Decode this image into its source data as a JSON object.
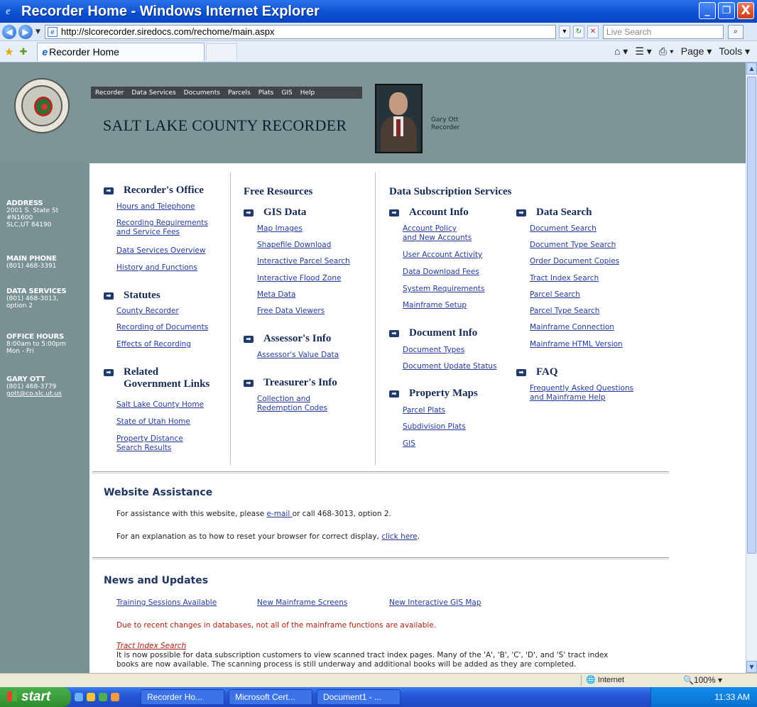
{
  "window": {
    "title": "Recorder Home - Windows Internet Explorer",
    "min": "_",
    "max": "❐",
    "close": "X"
  },
  "addressbar": {
    "url": "http://slcorecorder.siredocs.com/rechome/main.aspx",
    "search_placeholder": "Live Search"
  },
  "tabbar": {
    "tab_label": "Recorder Home",
    "tools": [
      "Page ▾",
      "Tools ▾"
    ]
  },
  "header": {
    "nav": [
      "Recorder",
      "Data Services",
      "Documents",
      "Parcels",
      "Plats",
      "GIS",
      "Help"
    ],
    "title": "SALT LAKE COUNTY RECORDER",
    "person_name": "Gary Ott",
    "person_title": "Recorder"
  },
  "sidebar": {
    "address_label": "ADDRESS",
    "address_lines": [
      "2001 S. State St",
      "#N1600",
      "SLC,UT 84190"
    ],
    "phone_label": "MAIN PHONE",
    "phone": "(801) 468-3391",
    "ds_label": "DATA SERVICES",
    "ds_lines": [
      "(801) 468-3013,",
      "option 2"
    ],
    "hours_label": "OFFICE HOURS",
    "hours_lines": [
      "8:00am to 5:00pm",
      "Mon - Fri"
    ],
    "contact_label": "GARY OTT",
    "contact_lines": [
      "(801) 468-3779",
      "gott@co.slc.ut.us"
    ]
  },
  "col1": {
    "recorders_office": "Recorder's Office",
    "ro_links": [
      "Hours and Telephone",
      "Recording Requirements",
      "and Service Fees",
      "Data Services Overview",
      "History and Functions"
    ],
    "statutes": "Statutes",
    "st_links": [
      "County Recorder",
      "Recording of Documents",
      "Effects of Recording"
    ],
    "related_1": "Related",
    "related_2": "Government Links",
    "rel_links": [
      "Salt Lake County Home",
      "State of Utah Home",
      "Property Distance",
      "Search Results"
    ]
  },
  "col2": {
    "heading": "Free Resources",
    "gis": "GIS Data",
    "gis_links": [
      "Map Images",
      "Shapefile Download",
      "Interactive Parcel Search",
      "Interactive Flood Zone",
      "Meta Data",
      "Free Data Viewers"
    ],
    "assessor": "Assessor's Info",
    "assessor_link": "Assessor's Value Data",
    "treasurer": "Treasurer's Info",
    "treasurer_links": [
      "Collection and",
      "Redemption Codes"
    ]
  },
  "col3": {
    "heading": "Data Subscription Services",
    "account": "Account Info",
    "acct_links": [
      "Account Policy",
      "and New Accounts",
      "User Account Activity",
      "Data Download Fees",
      "System Requirements",
      "Mainframe Setup"
    ],
    "docinfo": "Document Info",
    "doc_links": [
      "Document Types",
      "Document Update Status"
    ],
    "propmaps": "Property Maps",
    "pm_links": [
      "Parcel Plats",
      "Subdivision Plats",
      "GIS"
    ]
  },
  "col4": {
    "datasearch": "Data Search",
    "ds_links": [
      "Document Search",
      "Document Type Search",
      "Order Document Copies",
      "Tract Index Search",
      "Parcel Search",
      "Parcel Type Search",
      "Mainframe Connection",
      "Mainframe HTML Version"
    ],
    "faq": "FAQ",
    "faq_links": [
      "Frequently Asked Questions",
      "and Mainframe Help"
    ]
  },
  "assistance": {
    "heading": "Website Assistance",
    "line1_pre": "For assistance with this website, please ",
    "line1_link": "e-mail ",
    "line1_post": "or call 468-3013, option 2.",
    "line2_pre": "For an explanation as to how to reset your browser for correct display, ",
    "line2_link": "click here",
    "line2_post": "."
  },
  "news": {
    "heading": "News and Updates",
    "links": [
      "Training Sessions Available",
      "New Mainframe Screens",
      "New Interactive GIS Map"
    ],
    "notice": "Due to recent changes in databases, not all of the mainframe functions are available.",
    "tract_link": "Tract Index Search",
    "tract_text1": "It is now possible for data subscription customers to view scanned tract index pages. Many of the 'A', 'B', 'C', 'D', and 'S' tract index",
    "tract_text2": "books are now available. The scanning process is still underway and additional books will be added as they are completed."
  },
  "statusbar": {
    "zone": "Internet",
    "zoom": "100%"
  },
  "taskbar": {
    "start": "start",
    "tasks": [
      "Recorder Ho...",
      "Microsoft Cert...",
      "Document1 - ..."
    ],
    "clock": "11:33 AM"
  },
  "colors": {
    "header_bg": "#7d9597",
    "title_bar": "#0a4fd0",
    "link": "#243a9e",
    "notice_red": "#b0210f"
  }
}
